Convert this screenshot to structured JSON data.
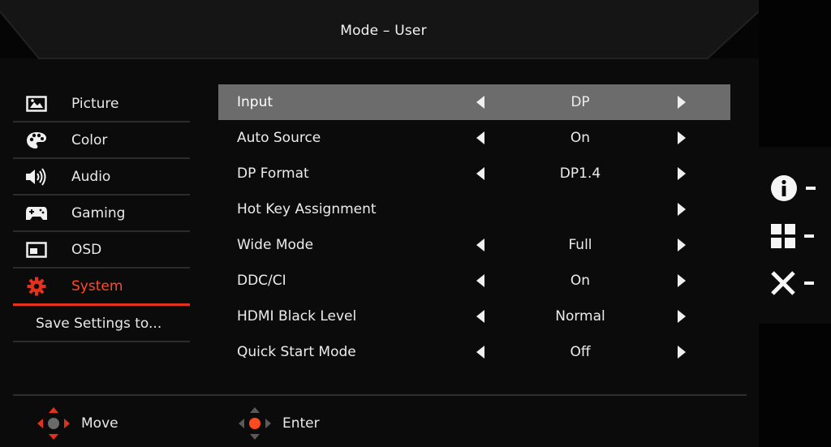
{
  "title": "Mode – User",
  "sidebar": {
    "items": [
      {
        "label": "Picture",
        "icon": "picture-icon"
      },
      {
        "label": "Color",
        "icon": "palette-icon"
      },
      {
        "label": "Audio",
        "icon": "speaker-icon"
      },
      {
        "label": "Gaming",
        "icon": "gamepad-icon"
      },
      {
        "label": "OSD",
        "icon": "osd-window-icon"
      },
      {
        "label": "System",
        "icon": "gear-icon"
      },
      {
        "label": "Save Settings to..."
      }
    ],
    "active": "System"
  },
  "settings": {
    "rows": [
      {
        "label": "Input",
        "value": "DP"
      },
      {
        "label": "Auto Source",
        "value": "On"
      },
      {
        "label": "DP Format",
        "value": "DP1.4"
      },
      {
        "label": "Hot Key Assignment",
        "value": ""
      },
      {
        "label": "Wide Mode",
        "value": "Full"
      },
      {
        "label": "DDC/CI",
        "value": "On"
      },
      {
        "label": "HDMI Black Level",
        "value": "Normal"
      },
      {
        "label": "Quick Start Mode",
        "value": "Off"
      }
    ],
    "selected": "Input"
  },
  "right_buttons": [
    {
      "icon": "info-icon"
    },
    {
      "icon": "grid-icon"
    },
    {
      "icon": "close-icon"
    }
  ],
  "hints": {
    "move_label": "Move",
    "enter_label": "Enter"
  },
  "colors": {
    "accent": "#e4311c",
    "selected_row": "#6c6c6c",
    "background": "#0b0b0b"
  }
}
